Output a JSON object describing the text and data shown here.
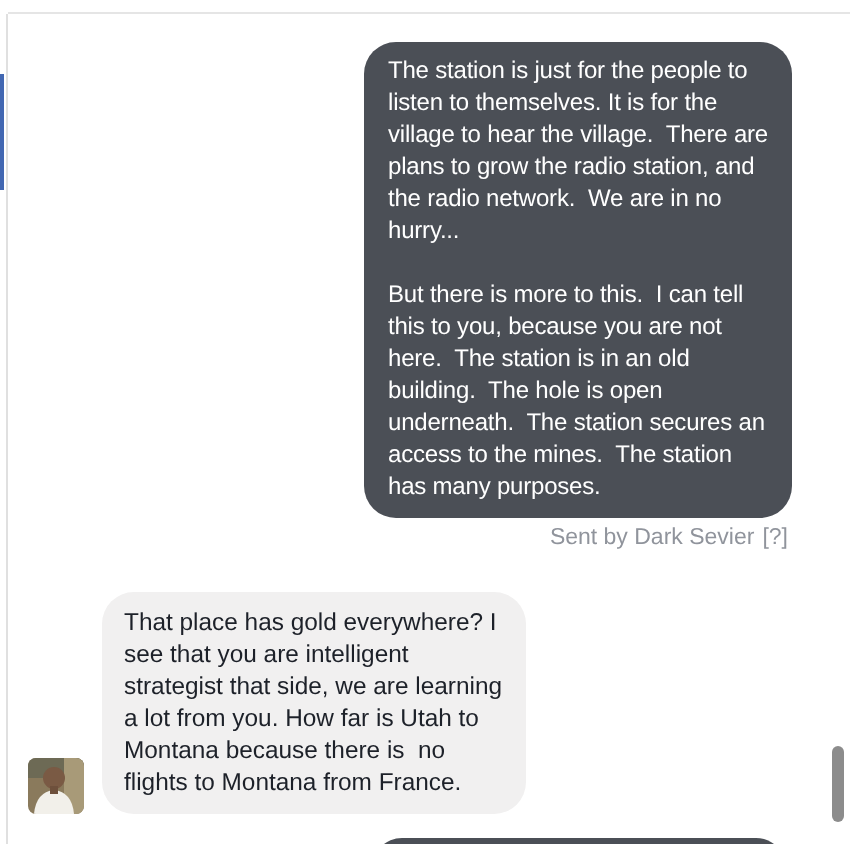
{
  "messages": [
    {
      "kind": "sent",
      "paragraphs": [
        "The station is just for the people to listen to themselves. It is for the village to hear the village.  There are plans to grow the radio station, and the radio network.  We are in no hurry...",
        "But there is more to this.  I can tell this to you, because you are not here.  The station is in an old building.  The hole is open underneath.  The station secures an access to the mines.  The station has many purposes."
      ],
      "sender_note": "Sent by Dark Sevier",
      "help": "[?]"
    },
    {
      "kind": "received",
      "paragraphs": [
        "That place has gold everywhere? I see that you are intelligent strategist that side, we are learning a lot from you. How far is Utah to Montana because there is  no flights to Montana from France."
      ],
      "avatar": {
        "kind": "picture"
      }
    },
    {
      "kind": "sent"
    }
  ]
}
